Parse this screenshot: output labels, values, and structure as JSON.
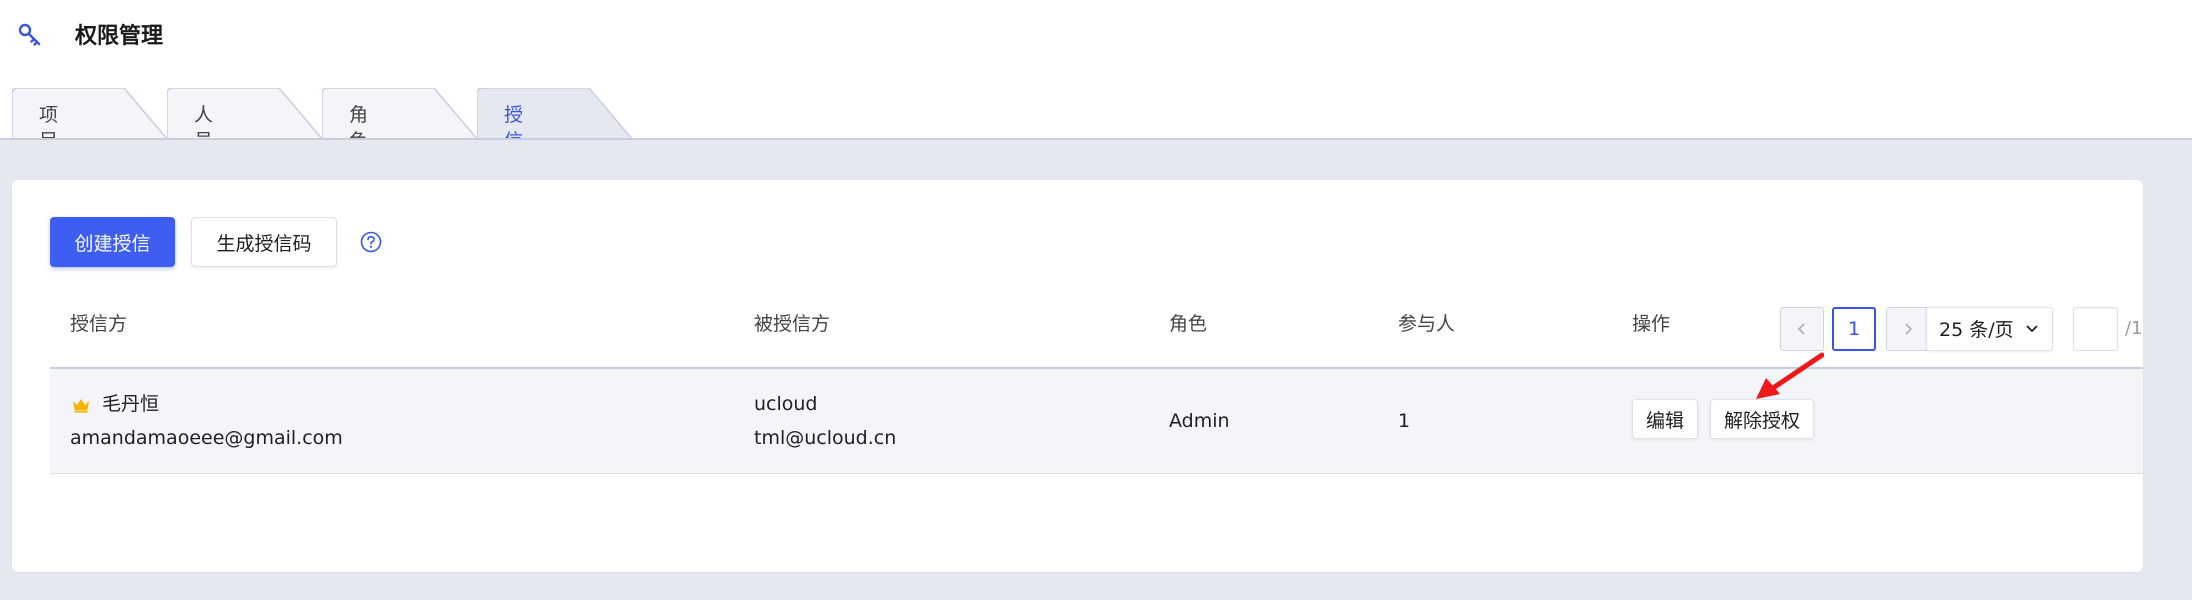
{
  "header": {
    "title": "权限管理",
    "icon": "key-icon"
  },
  "tabs": [
    {
      "label": "项目管理",
      "active": false
    },
    {
      "label": "人员管理",
      "active": false
    },
    {
      "label": "角色管理",
      "active": false
    },
    {
      "label": "授信管理",
      "active": true
    }
  ],
  "toolbar": {
    "create_label": "创建授信",
    "generate_label": "生成授信码",
    "help_icon": "question-circle-icon"
  },
  "table": {
    "columns": [
      "授信方",
      "被授信方",
      "角色",
      "参与人",
      "操作"
    ],
    "rows": [
      {
        "grantor_name": "毛丹恒",
        "grantor_email": "amandamaoeee@gmail.com",
        "grantee_name": "ucloud",
        "grantee_email": "tml@ucloud.cn",
        "role": "Admin",
        "participants": "1",
        "actions": [
          "编辑",
          "解除授权"
        ]
      }
    ]
  },
  "pagination": {
    "current_page": "1",
    "page_size": "25 条/页",
    "jump_value": "",
    "total_pages": "/1"
  },
  "colors": {
    "accent": "#3d5ef0",
    "tab_active": "#3a55e0",
    "content_bg": "#e6e8f1",
    "annotation_arrow": "#f01818",
    "crown": "#f5b400"
  }
}
